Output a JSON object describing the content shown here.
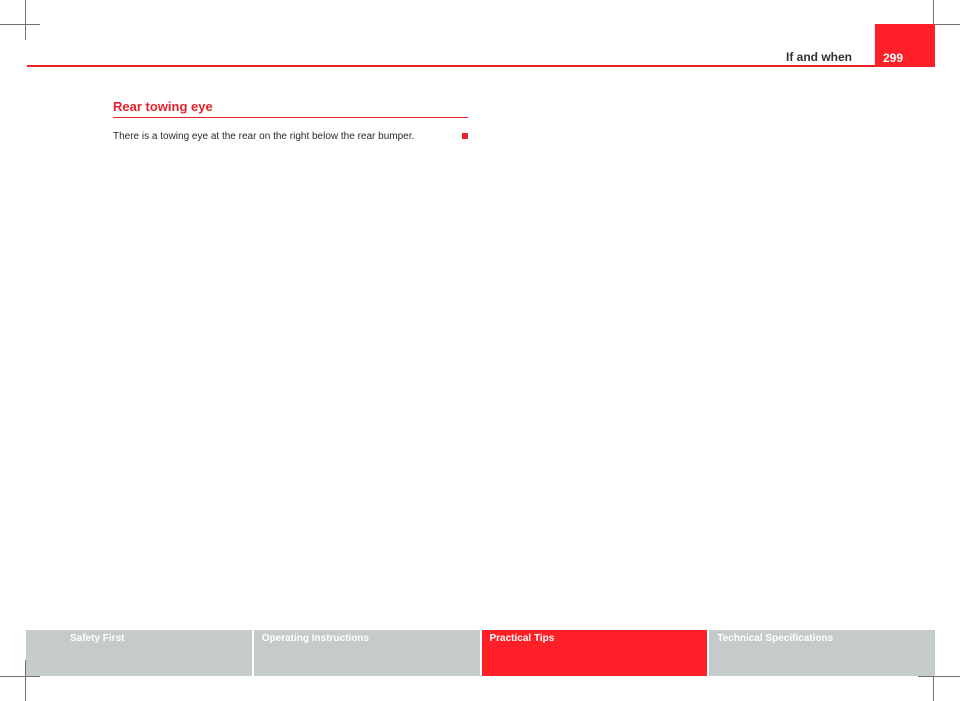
{
  "header": {
    "chapter_title": "If and when",
    "page_number": "299"
  },
  "section": {
    "heading": "Rear towing eye",
    "body": "There is a towing eye at the rear on the right below the rear bumper."
  },
  "footer": {
    "tabs": [
      {
        "label": "Safety First",
        "active": false
      },
      {
        "label": "Operating Instructions",
        "active": false
      },
      {
        "label": "Practical Tips",
        "active": true
      },
      {
        "label": "Technical Specifications",
        "active": false
      }
    ]
  },
  "colors": {
    "accent": "#ff1f26",
    "footer_inactive": "#c5cbca"
  }
}
